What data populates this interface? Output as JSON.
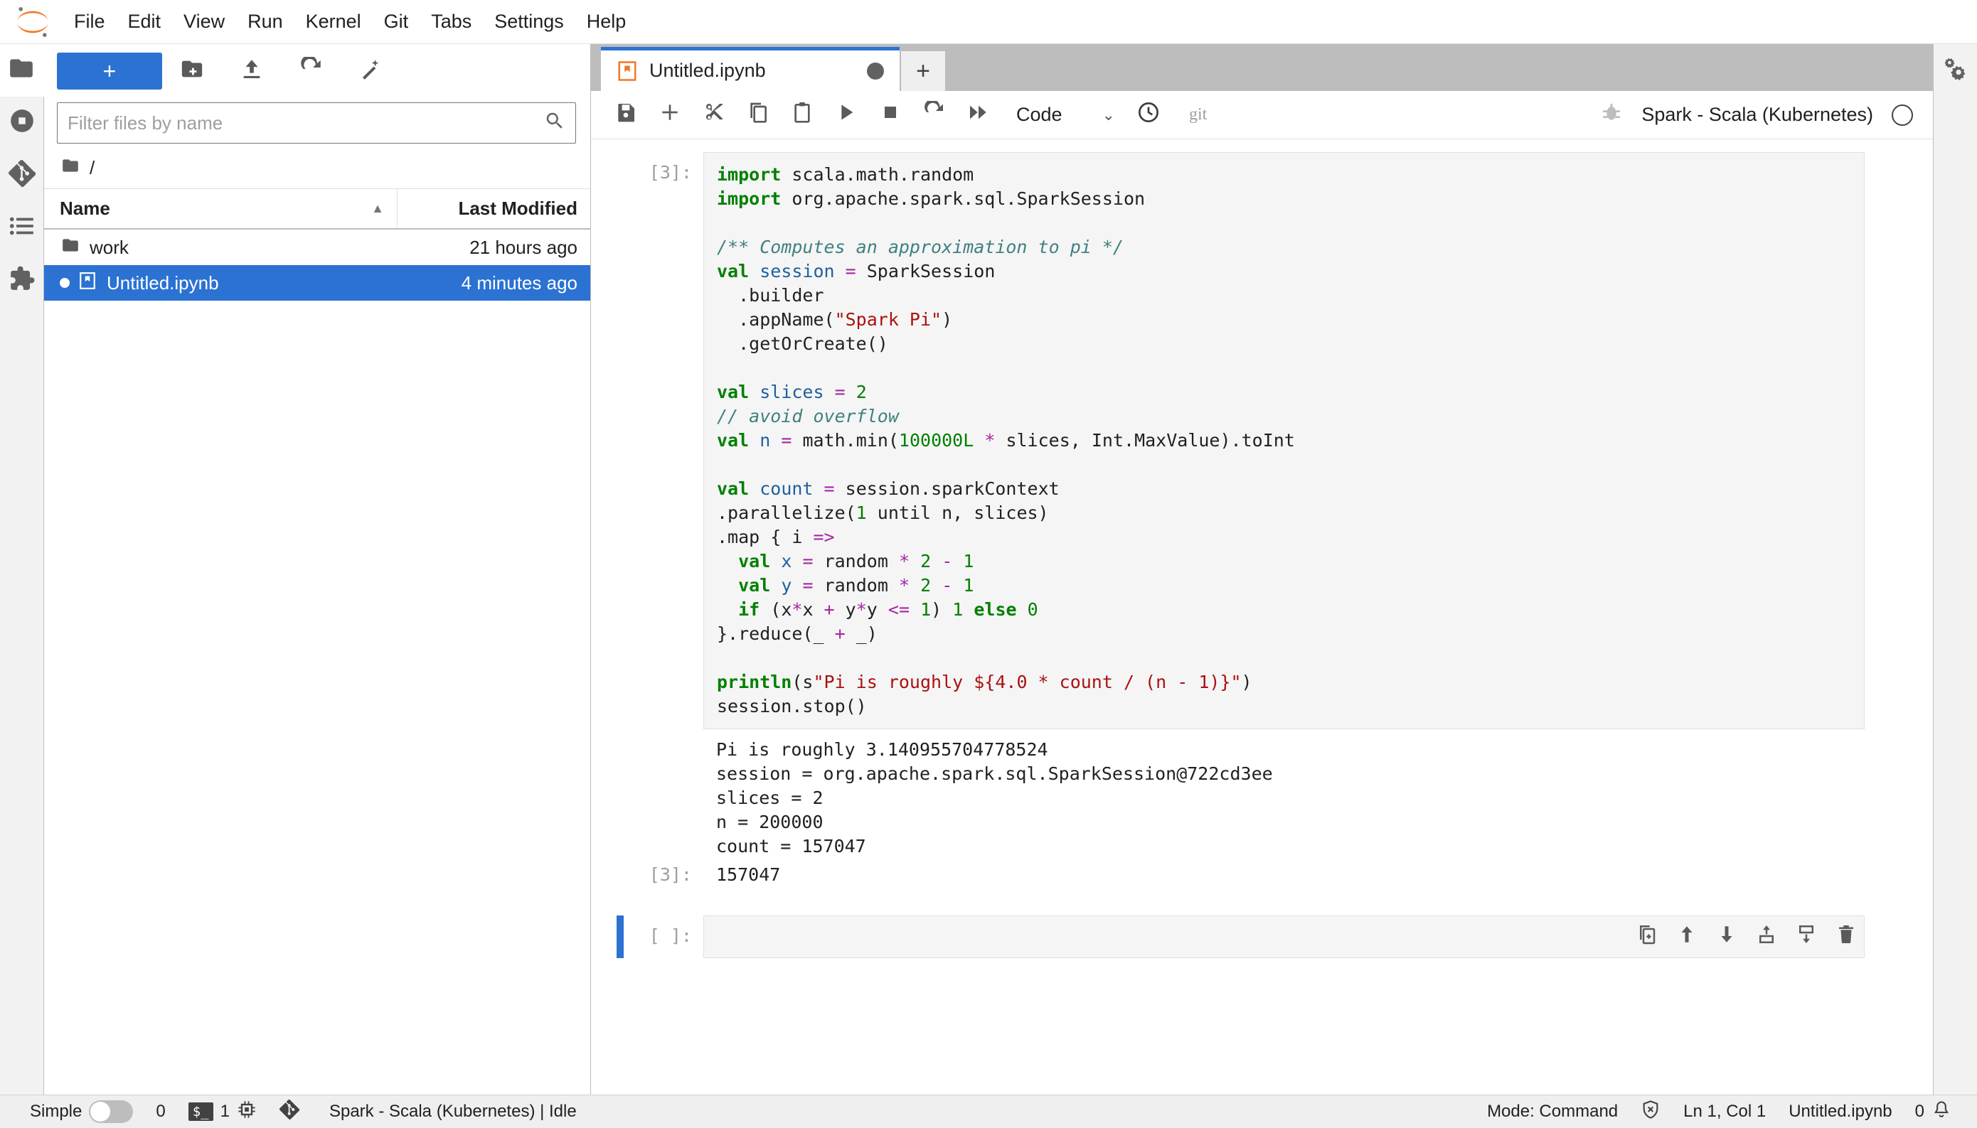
{
  "app": {
    "logo_name": "jupyter-logo"
  },
  "menubar": {
    "items": [
      {
        "label": "File"
      },
      {
        "label": "Edit"
      },
      {
        "label": "View"
      },
      {
        "label": "Run"
      },
      {
        "label": "Kernel"
      },
      {
        "label": "Git"
      },
      {
        "label": "Tabs"
      },
      {
        "label": "Settings"
      },
      {
        "label": "Help"
      }
    ]
  },
  "activity_bar": {
    "items": [
      {
        "name": "file-browser",
        "icon": "folder-icon",
        "active": true
      },
      {
        "name": "running-sessions",
        "icon": "stop-circle-icon",
        "active": false
      },
      {
        "name": "git-panel",
        "icon": "git-icon",
        "active": false
      },
      {
        "name": "table-of-contents",
        "icon": "list-icon",
        "active": false
      },
      {
        "name": "extension-manager",
        "icon": "puzzle-icon",
        "active": false
      }
    ]
  },
  "right_bar": {
    "items": [
      {
        "name": "property-inspector",
        "icon": "gears-icon"
      }
    ]
  },
  "filebrowser": {
    "new_launcher_label": "+",
    "toolbar": [
      {
        "name": "new-folder-button",
        "icon": "new-folder-icon"
      },
      {
        "name": "upload-button",
        "icon": "upload-icon"
      },
      {
        "name": "refresh-button",
        "icon": "refresh-icon"
      },
      {
        "name": "new-from-path-button",
        "icon": "wand-icon"
      }
    ],
    "filter": {
      "placeholder": "Filter files by name",
      "value": ""
    },
    "breadcrumb": "/",
    "columns": {
      "name": "Name",
      "last_modified": "Last Modified"
    },
    "sort_indicator": "▲",
    "rows": [
      {
        "name": "work",
        "modified": "21 hours ago",
        "type": "folder",
        "selected": false,
        "running": false
      },
      {
        "name": "Untitled.ipynb",
        "modified": "4 minutes ago",
        "type": "notebook",
        "selected": true,
        "running": true
      }
    ]
  },
  "tabbar": {
    "tabs": [
      {
        "label": "Untitled.ipynb",
        "icon": "notebook-icon",
        "dirty": true,
        "active": true
      }
    ],
    "add_tab_label": "+"
  },
  "notebook_toolbar": {
    "buttons": [
      {
        "name": "save-button",
        "icon": "save-icon"
      },
      {
        "name": "insert-cell-button",
        "icon": "plus-icon"
      },
      {
        "name": "cut-button",
        "icon": "scissors-icon"
      },
      {
        "name": "copy-button",
        "icon": "copy-icon"
      },
      {
        "name": "paste-button",
        "icon": "paste-icon"
      },
      {
        "name": "run-button",
        "icon": "play-icon"
      },
      {
        "name": "stop-button",
        "icon": "stop-icon"
      },
      {
        "name": "restart-kernel-button",
        "icon": "restart-icon"
      },
      {
        "name": "restart-run-all-button",
        "icon": "fast-forward-icon"
      }
    ],
    "cell_type": "Code",
    "chevron": "⌄",
    "history_icon": "clock-icon",
    "git_label": "git",
    "debugger_icon": "bug-icon",
    "kernel_name": "Spark - Scala (Kubernetes)",
    "kernel_status_icon": "idle-circle-icon"
  },
  "notebook": {
    "cells": [
      {
        "prompt": "[3]:",
        "active": false,
        "code_lines": [
          [
            {
              "t": "import",
              "c": "kw"
            },
            {
              "t": " scala.math.random"
            }
          ],
          [
            {
              "t": "import",
              "c": "kw"
            },
            {
              "t": " org.apache.spark.sql.SparkSession"
            }
          ],
          [
            {
              "t": ""
            }
          ],
          [
            {
              "t": "/** Computes an approximation to pi */",
              "c": "cmt"
            }
          ],
          [
            {
              "t": "val",
              "c": "kw"
            },
            {
              "t": " "
            },
            {
              "t": "session",
              "c": "var"
            },
            {
              "t": " "
            },
            {
              "t": "=",
              "c": "op"
            },
            {
              "t": " SparkSession"
            }
          ],
          [
            {
              "t": "  .builder"
            }
          ],
          [
            {
              "t": "  .appName("
            },
            {
              "t": "\"Spark Pi\"",
              "c": "str"
            },
            {
              "t": ")"
            }
          ],
          [
            {
              "t": "  .getOrCreate()"
            }
          ],
          [
            {
              "t": ""
            }
          ],
          [
            {
              "t": "val",
              "c": "kw"
            },
            {
              "t": " "
            },
            {
              "t": "slices",
              "c": "var"
            },
            {
              "t": " "
            },
            {
              "t": "=",
              "c": "op"
            },
            {
              "t": " "
            },
            {
              "t": "2",
              "c": "num"
            }
          ],
          [
            {
              "t": "// avoid overflow",
              "c": "cmt"
            }
          ],
          [
            {
              "t": "val",
              "c": "kw"
            },
            {
              "t": " "
            },
            {
              "t": "n",
              "c": "var"
            },
            {
              "t": " "
            },
            {
              "t": "=",
              "c": "op"
            },
            {
              "t": " math.min("
            },
            {
              "t": "100000L",
              "c": "num"
            },
            {
              "t": " "
            },
            {
              "t": "*",
              "c": "op"
            },
            {
              "t": " slices, Int.MaxValue).toInt"
            }
          ],
          [
            {
              "t": ""
            }
          ],
          [
            {
              "t": "val",
              "c": "kw"
            },
            {
              "t": " "
            },
            {
              "t": "count",
              "c": "var"
            },
            {
              "t": " "
            },
            {
              "t": "=",
              "c": "op"
            },
            {
              "t": " session.sparkContext"
            }
          ],
          [
            {
              "t": ".parallelize("
            },
            {
              "t": "1",
              "c": "num"
            },
            {
              "t": " until n, slices)"
            }
          ],
          [
            {
              "t": ".map { i "
            },
            {
              "t": "=>",
              "c": "op"
            }
          ],
          [
            {
              "t": "  "
            },
            {
              "t": "val",
              "c": "kw"
            },
            {
              "t": " "
            },
            {
              "t": "x",
              "c": "var"
            },
            {
              "t": " "
            },
            {
              "t": "=",
              "c": "op"
            },
            {
              "t": " random "
            },
            {
              "t": "*",
              "c": "op"
            },
            {
              "t": " "
            },
            {
              "t": "2",
              "c": "num"
            },
            {
              "t": " "
            },
            {
              "t": "-",
              "c": "op"
            },
            {
              "t": " "
            },
            {
              "t": "1",
              "c": "num"
            }
          ],
          [
            {
              "t": "  "
            },
            {
              "t": "val",
              "c": "kw"
            },
            {
              "t": " "
            },
            {
              "t": "y",
              "c": "var"
            },
            {
              "t": " "
            },
            {
              "t": "=",
              "c": "op"
            },
            {
              "t": " random "
            },
            {
              "t": "*",
              "c": "op"
            },
            {
              "t": " "
            },
            {
              "t": "2",
              "c": "num"
            },
            {
              "t": " "
            },
            {
              "t": "-",
              "c": "op"
            },
            {
              "t": " "
            },
            {
              "t": "1",
              "c": "num"
            }
          ],
          [
            {
              "t": "  "
            },
            {
              "t": "if",
              "c": "kw"
            },
            {
              "t": " (x"
            },
            {
              "t": "*",
              "c": "op"
            },
            {
              "t": "x "
            },
            {
              "t": "+",
              "c": "op"
            },
            {
              "t": " y"
            },
            {
              "t": "*",
              "c": "op"
            },
            {
              "t": "y "
            },
            {
              "t": "<=",
              "c": "op"
            },
            {
              "t": " "
            },
            {
              "t": "1",
              "c": "num"
            },
            {
              "t": ") "
            },
            {
              "t": "1",
              "c": "num"
            },
            {
              "t": " "
            },
            {
              "t": "else",
              "c": "kw"
            },
            {
              "t": " "
            },
            {
              "t": "0",
              "c": "num"
            }
          ],
          [
            {
              "t": "}.reduce(_ "
            },
            {
              "t": "+",
              "c": "op"
            },
            {
              "t": " _)"
            }
          ],
          [
            {
              "t": ""
            }
          ],
          [
            {
              "t": "println",
              "c": "fn"
            },
            {
              "t": "(s"
            },
            {
              "t": "\"Pi is roughly ${4.0 * count / (n - 1)}\"",
              "c": "str"
            },
            {
              "t": ")"
            }
          ],
          [
            {
              "t": "session.stop()"
            }
          ]
        ],
        "stdout": [
          "Pi is roughly 3.140955704778524",
          "session = org.apache.spark.sql.SparkSession@722cd3ee",
          "slices = 2",
          "n = 200000",
          "count = 157047"
        ],
        "result_prompt": "[3]:",
        "result": "157047"
      },
      {
        "prompt": "[ ]:",
        "active": true,
        "code_lines": [],
        "toolbar": [
          {
            "name": "duplicate-cell-button",
            "icon": "duplicate-icon"
          },
          {
            "name": "move-cell-up-button",
            "icon": "arrow-up-icon"
          },
          {
            "name": "move-cell-down-button",
            "icon": "arrow-down-icon"
          },
          {
            "name": "insert-cell-above-button",
            "icon": "insert-above-icon"
          },
          {
            "name": "insert-cell-below-button",
            "icon": "insert-below-icon"
          },
          {
            "name": "delete-cell-button",
            "icon": "trash-icon"
          }
        ]
      }
    ]
  },
  "statusbar": {
    "simple_label": "Simple",
    "simple_on": false,
    "kernel_count": "0",
    "terminal_badge": "$_",
    "terminal_count": "1",
    "cpu_icon": "cpu-icon",
    "git_icon": "git-icon",
    "kernel_status": "Spark - Scala (Kubernetes) | Idle",
    "mode": "Mode: Command",
    "trust_icon": "shield-x-icon",
    "cursor_position": "Ln 1, Col 1",
    "filename": "Untitled.ipynb",
    "notification_count": "0",
    "bell_icon": "bell-icon"
  },
  "colors": {
    "accent_blue": "#2b72d2",
    "jupyter_orange": "#f37726",
    "panel_gray": "#f2f2f2",
    "chrome_gray": "#bdbdbd"
  }
}
